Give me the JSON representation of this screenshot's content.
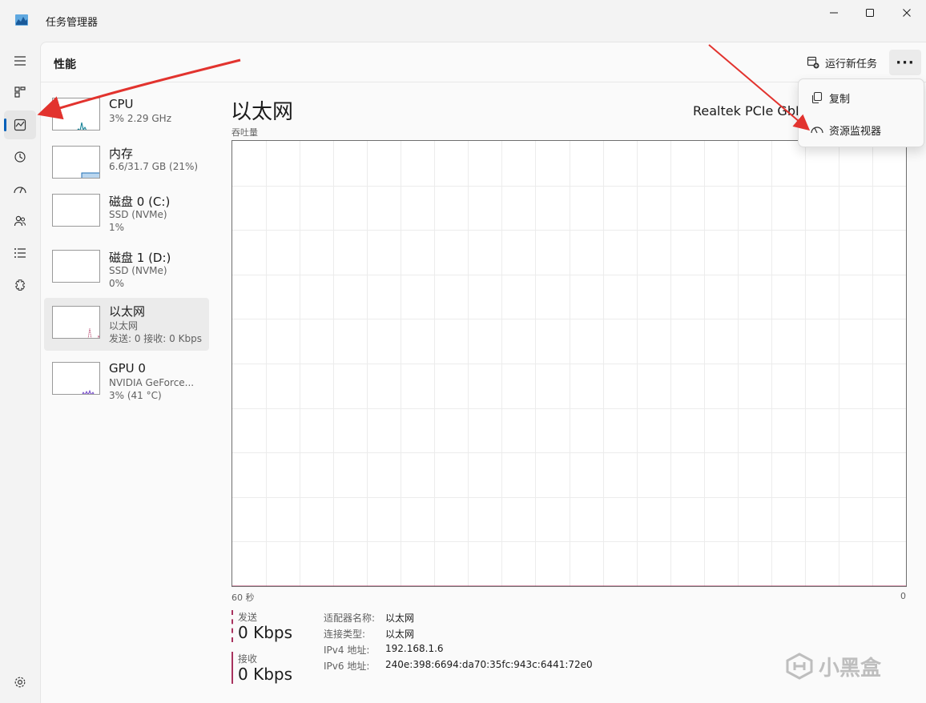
{
  "window": {
    "title": "任务管理器",
    "icon": "task-manager-app-icon",
    "controls": [
      "minimize-icon",
      "maximize-icon",
      "close-icon"
    ]
  },
  "nav": {
    "items": [
      {
        "name": "hamburger-menu-icon"
      },
      {
        "name": "processes-icon"
      },
      {
        "name": "performance-icon",
        "active": true
      },
      {
        "name": "app-history-icon"
      },
      {
        "name": "startup-apps-icon"
      },
      {
        "name": "users-icon"
      },
      {
        "name": "details-icon"
      },
      {
        "name": "services-icon"
      },
      {
        "name": "settings-icon"
      }
    ]
  },
  "header": {
    "title": "性能",
    "run_task_label": "运行新任务",
    "more_label": "···"
  },
  "menu": {
    "items": [
      {
        "label": "复制",
        "icon": "copy-icon"
      },
      {
        "label": "资源监视器",
        "icon": "resource-monitor-icon"
      }
    ]
  },
  "devices": [
    {
      "name": "CPU",
      "line1": "3% 2.29 GHz",
      "line2": "",
      "color": "#0f7e93"
    },
    {
      "name": "内存",
      "line1": "6.6/31.7 GB (21%)",
      "line2": "",
      "color": "#1f6fb5"
    },
    {
      "name": "磁盘 0 (C:)",
      "line1": "SSD (NVMe)",
      "line2": "1%",
      "color": "#3c8a28"
    },
    {
      "name": "磁盘 1 (D:)",
      "line1": "SSD (NVMe)",
      "line2": "0%",
      "color": "#3c8a28"
    },
    {
      "name": "以太网",
      "line1": "以太网",
      "line2": "发送: 0 接收: 0 Kbps",
      "color": "#b0305c",
      "selected": true
    },
    {
      "name": "GPU 0",
      "line1": "NVIDIA GeForce...",
      "line2": "3% (41 °C)",
      "color": "#6b3fc4"
    }
  ],
  "main": {
    "title": "以太网",
    "adapter": "Realtek PCIe GbE",
    "y_label": "吞吐量",
    "x_left": "60 秒",
    "x_right": "0",
    "send_label": "发送",
    "send_value": "0 Kbps",
    "recv_label": "接收",
    "recv_value": "0 Kbps",
    "send_color": "#a8325e",
    "recv_color": "#a8325e"
  },
  "properties": [
    {
      "key": "适配器名称:",
      "value": "以太网"
    },
    {
      "key": "连接类型:",
      "value": "以太网"
    },
    {
      "key": "IPv4 地址:",
      "value": "192.168.1.6"
    },
    {
      "key": "IPv6 地址:",
      "value": "240e:398:6694:da70:35fc:943c:6441:72e0"
    }
  ],
  "watermark": "小黑盒",
  "chart_data": {
    "type": "line",
    "x": [
      60,
      58,
      56,
      54,
      52,
      50,
      48,
      46,
      44,
      42,
      40,
      38,
      36,
      34,
      32,
      30,
      28,
      26,
      24,
      22,
      20,
      18,
      16,
      14,
      12,
      10,
      9,
      8,
      7,
      6,
      5,
      4,
      3,
      2,
      1,
      0
    ],
    "series": [
      {
        "name": "发送",
        "values": [
          0,
          0,
          0,
          0,
          0,
          0,
          0,
          0,
          0,
          0,
          0,
          0,
          0,
          0,
          0,
          0,
          0,
          0,
          0,
          0,
          0,
          0,
          0,
          0,
          0,
          0,
          0,
          0,
          0,
          0,
          0,
          0,
          0,
          0,
          0,
          0
        ],
        "style": "dashed"
      },
      {
        "name": "接收",
        "values": [
          0,
          0,
          0,
          0,
          0,
          0,
          0,
          0,
          0,
          0,
          0,
          0,
          0,
          0,
          0,
          0,
          0,
          0,
          0,
          0,
          0,
          0,
          0,
          0,
          0,
          0,
          0,
          0,
          0,
          0,
          0,
          0,
          0,
          0,
          0,
          0
        ],
        "style": "solid-fill"
      }
    ],
    "xlabel": "60 秒",
    "ylabel": "吞吐量",
    "grid": true,
    "grid_cols": 20,
    "grid_rows": 10
  }
}
